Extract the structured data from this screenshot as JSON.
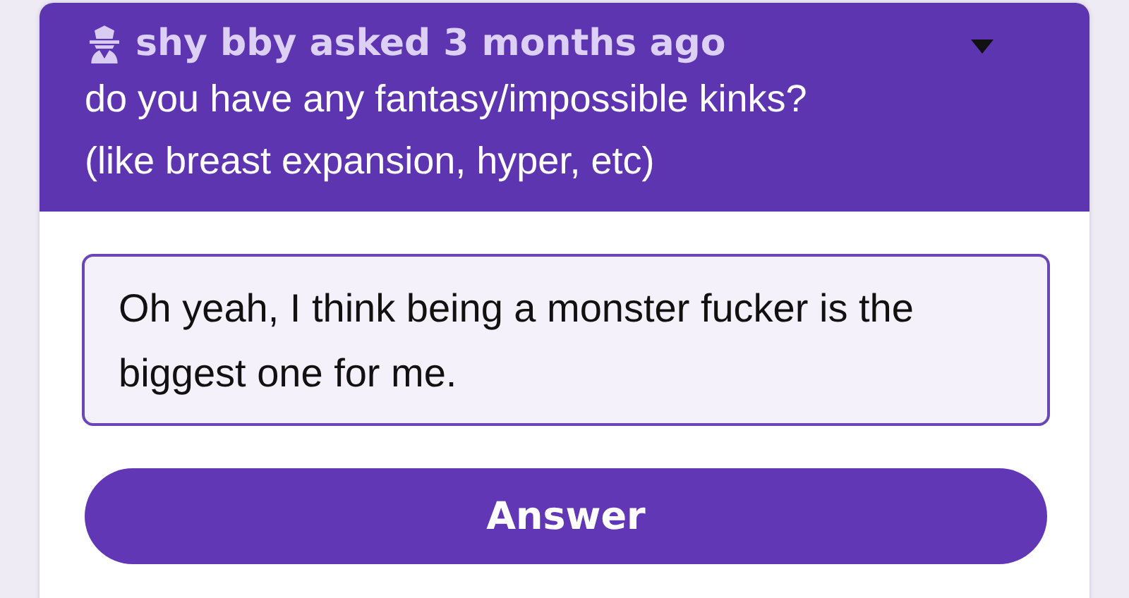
{
  "question": {
    "asker": "shy bby asked 3 months ago",
    "text": "do you have any fantasy/impossible kinks? (like breast expansion, hyper, etc)"
  },
  "answer": {
    "value": "Oh yeah, I think being a monster fucker is the biggest one for me."
  },
  "buttons": [
    "Answer"
  ]
}
